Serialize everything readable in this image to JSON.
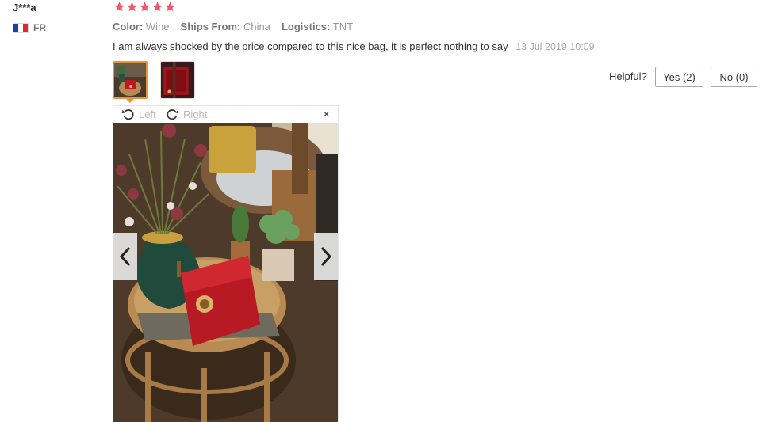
{
  "review": {
    "user": "J***a",
    "country": "FR",
    "rating": 5,
    "attributes": [
      {
        "label": "Color:",
        "value": "Wine"
      },
      {
        "label": "Ships From:",
        "value": "China"
      },
      {
        "label": "Logistics:",
        "value": "TNT"
      }
    ],
    "text": "I am always shocked by the price compared to this nice bag, it is perfect nothing to say",
    "date": "13 Jul 2019 10:09"
  },
  "helpful": {
    "label": "Helpful?",
    "yes_label": "Yes (2)",
    "no_label": "No (0)"
  },
  "viewer": {
    "rotate_left_label": "Left",
    "rotate_right_label": "Right",
    "close_label": "×"
  },
  "colors": {
    "star": "#f0586c",
    "thumb_active_border": "#e8963c",
    "flag": [
      "#1a3fa6",
      "#ffffff",
      "#e3262f"
    ]
  },
  "icons": [
    "star-icon",
    "flag-fr-icon",
    "rotate-left-icon",
    "rotate-right-icon",
    "close-icon",
    "chevron-left-icon",
    "chevron-right-icon"
  ]
}
